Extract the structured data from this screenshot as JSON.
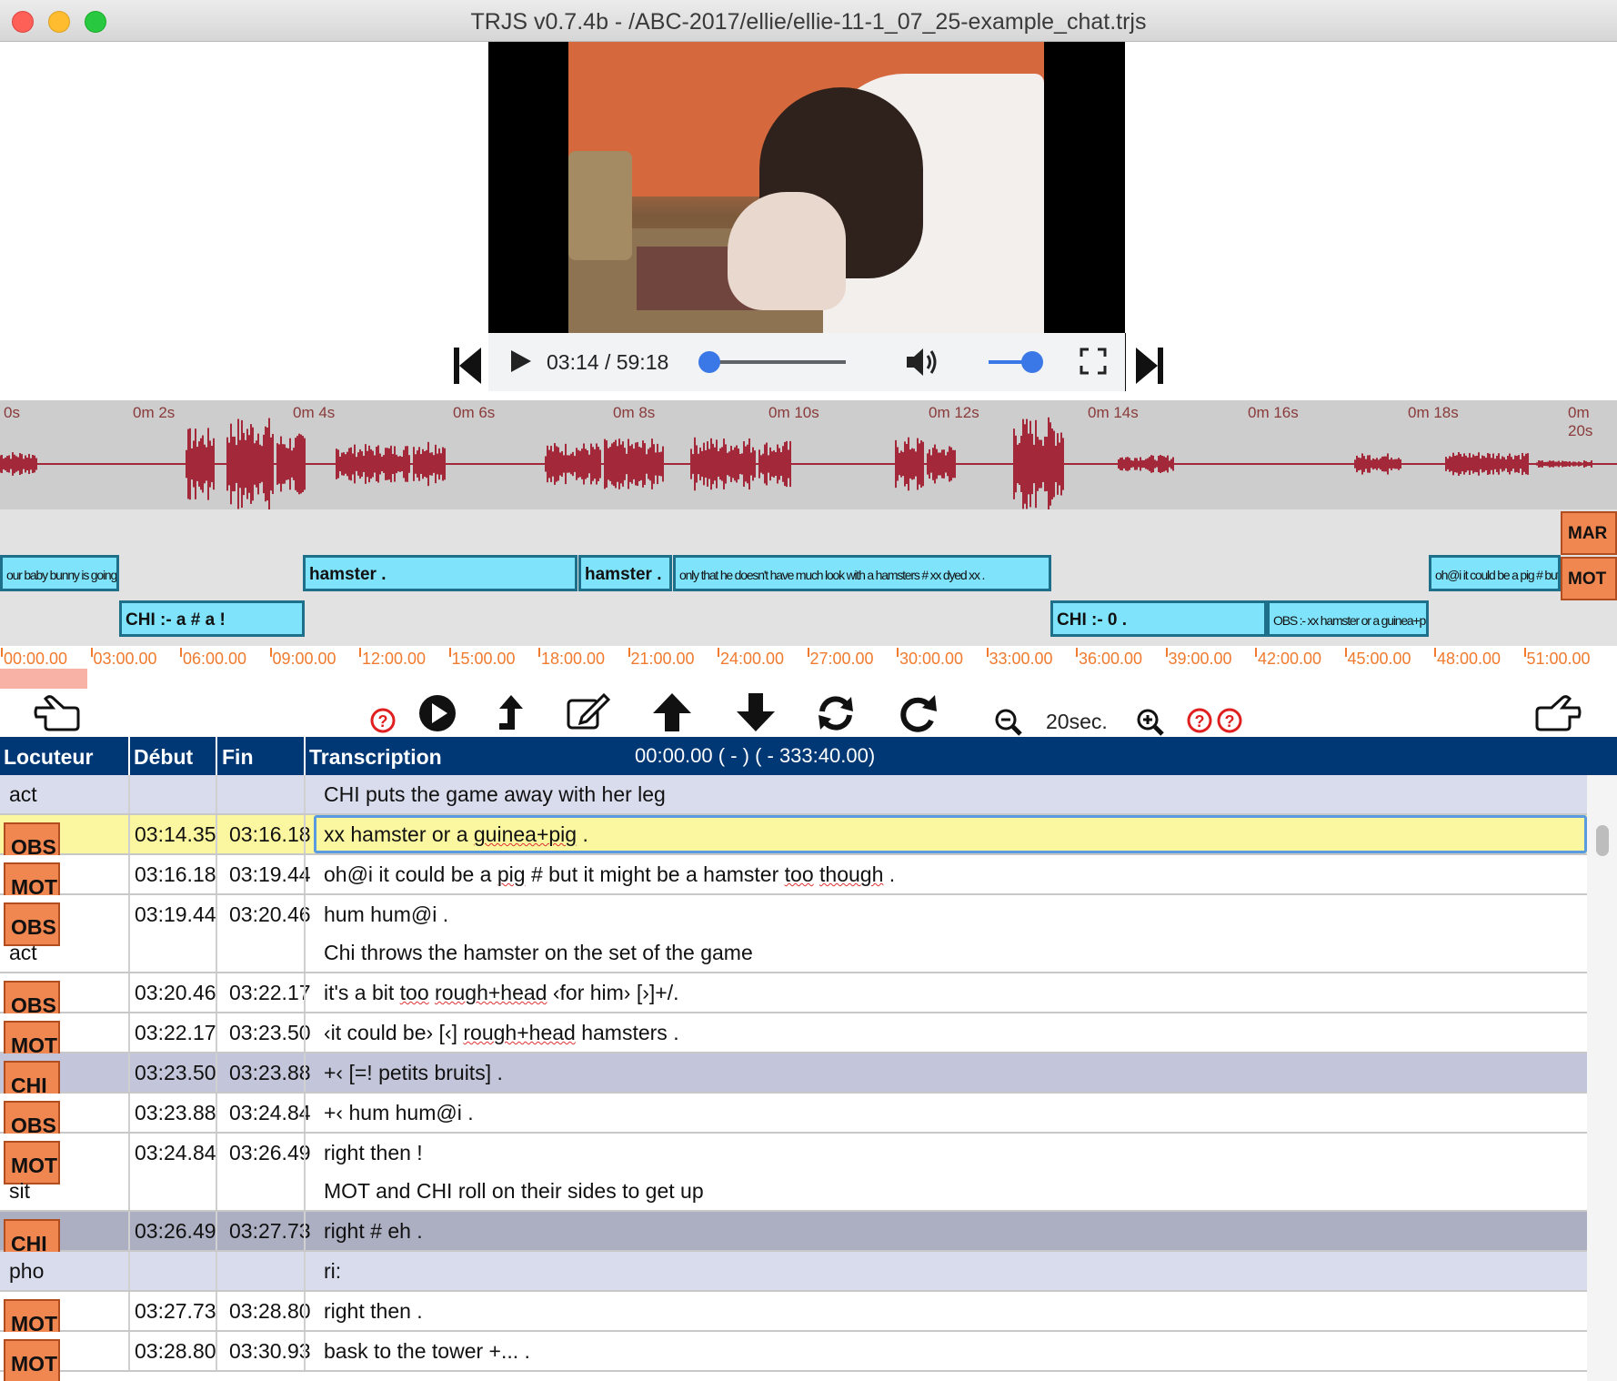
{
  "window": {
    "title": "TRJS v0.7.4b - /ABC-2017/ellie/ellie-11-1_07_25-example_chat.trjs"
  },
  "player": {
    "time": "03:14 / 59:18"
  },
  "waveform": {
    "ticks": [
      "0s",
      "0m 2s",
      "0m 4s",
      "0m 6s",
      "0m 8s",
      "0m 10s",
      "0m 12s",
      "0m 14s",
      "0m 16s",
      "0m 18s",
      "0m 20s"
    ]
  },
  "tiers": {
    "speakers": [
      "MAR",
      "MOT"
    ],
    "segments": [
      {
        "text": "our baby bunny is going to eat your @ & [+ inf] !"
      },
      {
        "text": "hamster ."
      },
      {
        "text": "hamster ."
      },
      {
        "text": "only that he doesn't have much look with a hamsters # xx dyed xx ."
      },
      {
        "text": "oh@i it could be a pig # but it might be a hamster too though ."
      },
      {
        "text": "CHI :- a # a !"
      },
      {
        "text": "CHI :- 0 ."
      },
      {
        "text": "OBS :- xx hamster or a guinea+pig ."
      }
    ]
  },
  "timescale": {
    "labels": [
      "00:00.00",
      "03:00.00",
      "06:00.00",
      "09:00.00",
      "12:00.00",
      "15:00.00",
      "18:00.00",
      "21:00.00",
      "24:00.00",
      "27:00.00",
      "30:00.00",
      "33:00.00",
      "36:00.00",
      "39:00.00",
      "42:00.00",
      "45:00.00",
      "48:00.00",
      "51:00.00"
    ]
  },
  "toolbar": {
    "zoom_label": "20sec."
  },
  "table": {
    "headers": {
      "speaker": "Locuteur",
      "start": "Début",
      "end": "Fin",
      "transcription": "Transcription"
    },
    "time_info": "00:00.00 ( - )  ( - 333:40.00)",
    "rows": [
      {
        "lines": [
          {
            "spk": "act",
            "dep": true,
            "deb": "",
            "fin": "",
            "tr": "CHI puts the game away with her leg"
          }
        ],
        "style": "light"
      },
      {
        "lines": [
          {
            "spk": "OBS",
            "deb": "03:14.35",
            "fin": "03:16.18",
            "tr": "xx hamster or a guinea+pig ."
          }
        ],
        "style": "sel"
      },
      {
        "lines": [
          {
            "spk": "MOT",
            "deb": "03:16.18",
            "fin": "03:19.44",
            "tr": "oh@i it could be a pig # but it might be a hamster too though ."
          }
        ],
        "style": ""
      },
      {
        "lines": [
          {
            "spk": "OBS",
            "deb": "03:19.44",
            "fin": "03:20.46",
            "tr": "hum hum@i ."
          },
          {
            "spk": "act",
            "dep": true,
            "deb": "",
            "fin": "",
            "tr": "Chi throws the hamster on the set of the game"
          }
        ],
        "style": ""
      },
      {
        "lines": [
          {
            "spk": "OBS",
            "deb": "03:20.46",
            "fin": "03:22.17",
            "tr": "it's a bit too rough+head ‹for him› [›]+/."
          }
        ],
        "style": ""
      },
      {
        "lines": [
          {
            "spk": "MOT",
            "deb": "03:22.17",
            "fin": "03:23.50",
            "tr": "‹it could be› [‹] rough+head hamsters ."
          }
        ],
        "style": ""
      },
      {
        "lines": [
          {
            "spk": "CHI",
            "deb": "03:23.50",
            "fin": "03:23.88",
            "tr": "+‹ [=! petits bruits] ."
          }
        ],
        "style": "mid"
      },
      {
        "lines": [
          {
            "spk": "OBS",
            "deb": "03:23.88",
            "fin": "03:24.84",
            "tr": "+‹ hum hum@i ."
          }
        ],
        "style": ""
      },
      {
        "lines": [
          {
            "spk": "MOT",
            "deb": "03:24.84",
            "fin": "03:26.49",
            "tr": "right then !"
          },
          {
            "spk": "sit",
            "dep": true,
            "deb": "",
            "fin": "",
            "tr": "MOT and CHI roll on their sides to get up"
          }
        ],
        "style": ""
      },
      {
        "lines": [
          {
            "spk": "CHI",
            "deb": "03:26.49",
            "fin": "03:27.73",
            "tr": "right # eh ."
          }
        ],
        "style": "dark"
      },
      {
        "lines": [
          {
            "spk": "pho",
            "dep": true,
            "deb": "",
            "fin": "",
            "tr": "ri:"
          }
        ],
        "style": "light"
      },
      {
        "lines": [
          {
            "spk": "MOT",
            "deb": "03:27.73",
            "fin": "03:28.80",
            "tr": "right then ."
          }
        ],
        "style": ""
      },
      {
        "lines": [
          {
            "spk": "MOT",
            "deb": "03:28.80",
            "fin": "03:30.93",
            "tr": "bask to the tower +... ."
          }
        ],
        "style": ""
      }
    ]
  },
  "colors": {
    "header_bg": "#003875",
    "tier_segment": "#7fe3fb",
    "speaker_box": "#f08650",
    "waveform": "#a3283a",
    "timescale": "#f07b2e",
    "selected_row": "#fbf7a0"
  },
  "icons": [
    "prev-icon",
    "play-icon",
    "volume-icon",
    "fullscreen-icon",
    "next-icon",
    "hand-left-icon",
    "help-icon",
    "play-circle-icon",
    "upload-arrow-icon",
    "edit-icon",
    "arrow-up-icon",
    "arrow-down-icon",
    "refresh-icon",
    "redo-icon",
    "zoom-out-icon",
    "zoom-in-icon",
    "hand-right-icon"
  ]
}
